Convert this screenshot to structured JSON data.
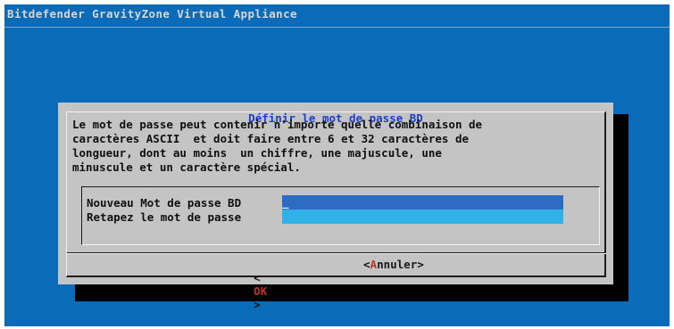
{
  "window": {
    "title": "Bitdefender GravityZone Virtual Appliance"
  },
  "dialog": {
    "title": "Définir le mot de passe BD",
    "description": "Le mot de passe peut contenir n'importe quelle combinaison de\ncaractères ASCII  et doit faire entre 6 et 32 caractères de\nlongueur, dont au moins  un chiffre, une majuscule, une\nminuscule et un caractère spécial.",
    "fields": [
      {
        "label": "Nouveau Mot de passe BD",
        "value": "",
        "cursor": "_",
        "state": "focused"
      },
      {
        "label": "Retapez le mot de passe",
        "value": "",
        "state": "idle"
      }
    ],
    "buttons": {
      "ok": {
        "open": "<",
        "hotkey": "O",
        "rest": "K",
        "close": ">"
      },
      "cancel": {
        "open": "<",
        "hotkey": "A",
        "rest": "nnuler",
        "close": ">"
      }
    }
  },
  "colors": {
    "background": "#0a6cb8",
    "dialog": "#c4c4c4",
    "title_text": "#1e3fc8",
    "focused_field": "#2d6bc4",
    "idle_field": "#30b2e8",
    "hotkey": "#b8352d"
  }
}
